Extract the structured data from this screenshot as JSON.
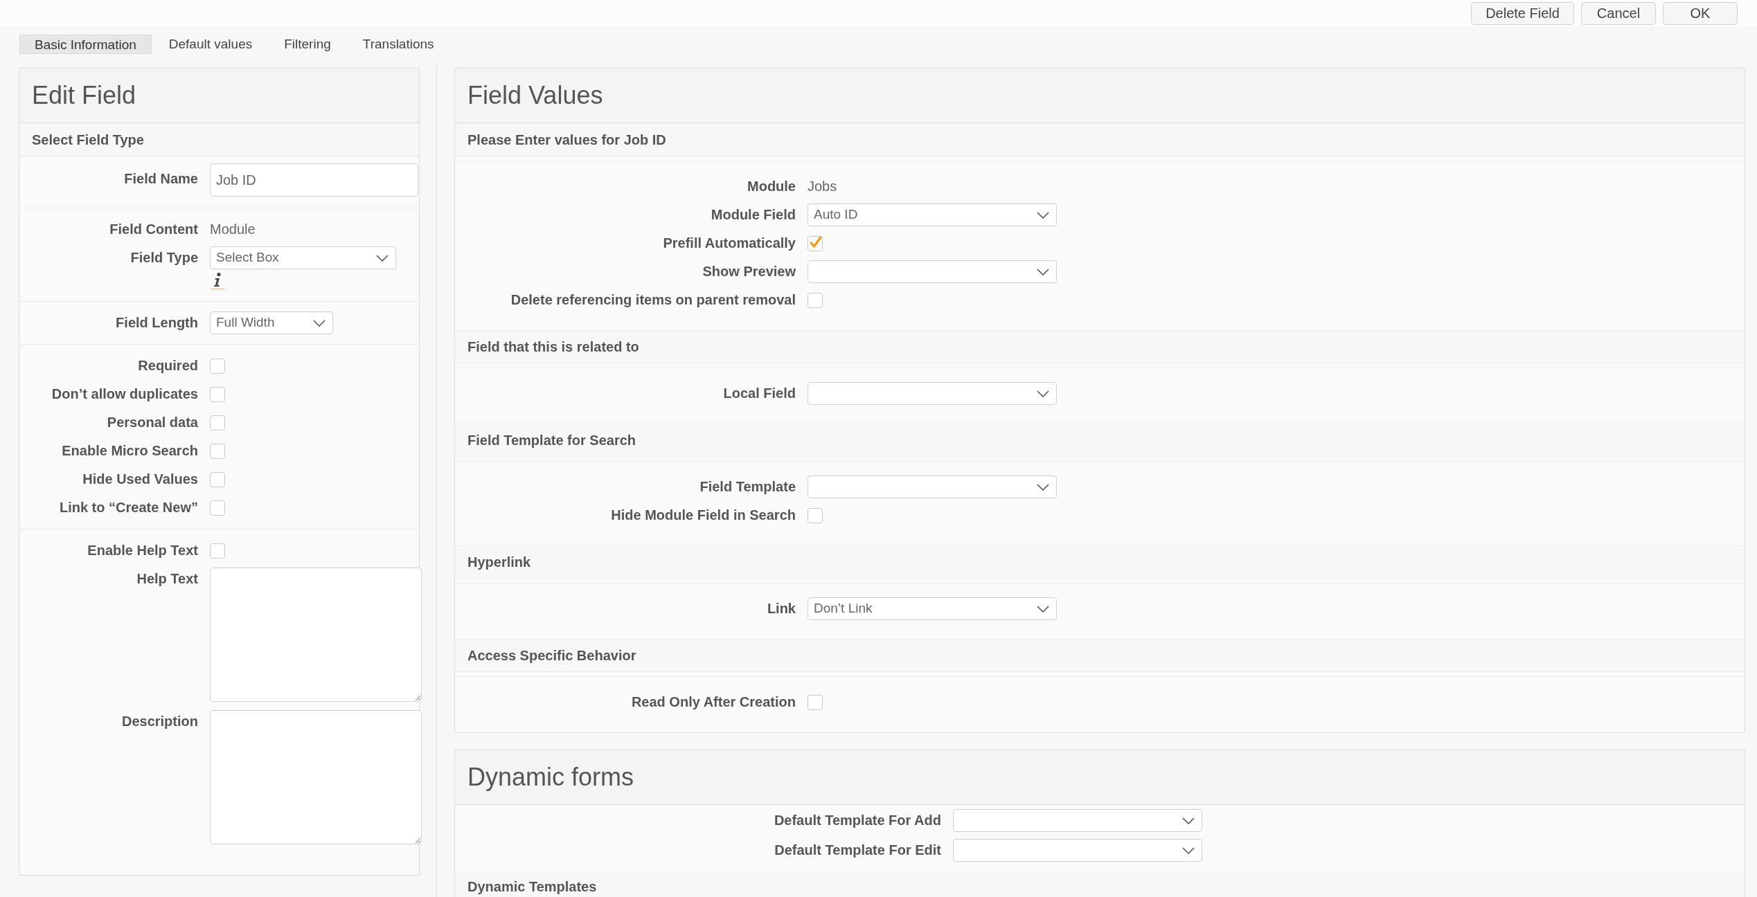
{
  "top_buttons": [
    "Delete Field",
    "Cancel",
    "OK"
  ],
  "tabs": [
    {
      "label": "Basic Information",
      "selected": true
    },
    {
      "label": "Default values",
      "selected": false
    },
    {
      "label": "Filtering",
      "selected": false
    },
    {
      "label": "Translations",
      "selected": false
    }
  ],
  "edit_field": {
    "title": "Edit Field",
    "section": "Select Field Type",
    "groups": [
      [
        {
          "kind": "input",
          "label": "Field Name",
          "value": "Job ID"
        }
      ],
      [
        {
          "kind": "static",
          "label": "Field Content",
          "value": "Module"
        },
        {
          "kind": "select",
          "label": "Field Type",
          "value": "Select Box",
          "info_icon": true
        }
      ],
      [
        {
          "kind": "select",
          "label": "Field Length",
          "value": "Full Width"
        }
      ],
      [
        {
          "kind": "checkbox",
          "label": "Required",
          "checked": false
        },
        {
          "kind": "checkbox",
          "label": "Don’t allow duplicates",
          "checked": false
        },
        {
          "kind": "checkbox",
          "label": "Personal data",
          "checked": false
        },
        {
          "kind": "checkbox",
          "label": "Enable Micro Search",
          "checked": false
        },
        {
          "kind": "checkbox",
          "label": "Hide Used Values",
          "checked": false
        },
        {
          "kind": "checkbox",
          "label": "Link to “Create New”",
          "checked": false
        }
      ],
      [
        {
          "kind": "checkbox",
          "label": "Enable Help Text",
          "checked": false
        },
        {
          "kind": "textarea",
          "label": "Help Text"
        },
        {
          "kind": "textarea",
          "label": "Description"
        }
      ]
    ]
  },
  "field_values": {
    "title": "Field Values",
    "sections": [
      {
        "heading": "Please Enter values for Job ID",
        "rows": [
          {
            "kind": "static",
            "label": "Module",
            "value": "Jobs"
          },
          {
            "kind": "select",
            "label": "Module Field",
            "value": "Auto ID"
          },
          {
            "kind": "checkbox",
            "label": "Prefill Automatically",
            "checked": true
          },
          {
            "kind": "select",
            "label": "Show Preview"
          },
          {
            "kind": "checkbox",
            "label": "Delete referencing items on parent removal",
            "checked": false
          }
        ]
      },
      {
        "heading": "Field that this is related to",
        "rows": [
          {
            "kind": "select",
            "label": "Local Field"
          }
        ]
      },
      {
        "heading": "Field Template for Search",
        "rows": [
          {
            "kind": "select",
            "label": "Field Template"
          },
          {
            "kind": "checkbox",
            "label": "Hide Module Field in Search",
            "checked": false
          }
        ]
      },
      {
        "heading": "Hyperlink",
        "rows": [
          {
            "kind": "select",
            "label": "Link",
            "value": "Don’t Link"
          }
        ]
      },
      {
        "heading": "Access Specific Behavior",
        "rows": [
          {
            "kind": "checkbox",
            "label": "Read Only After Creation",
            "checked": false
          }
        ]
      }
    ]
  },
  "dynamic_forms": {
    "title": "Dynamic forms",
    "rows": [
      {
        "kind": "select",
        "label": "Default Template For Add"
      },
      {
        "kind": "select",
        "label": "Default Template For Edit"
      }
    ],
    "section": "Dynamic Templates"
  }
}
